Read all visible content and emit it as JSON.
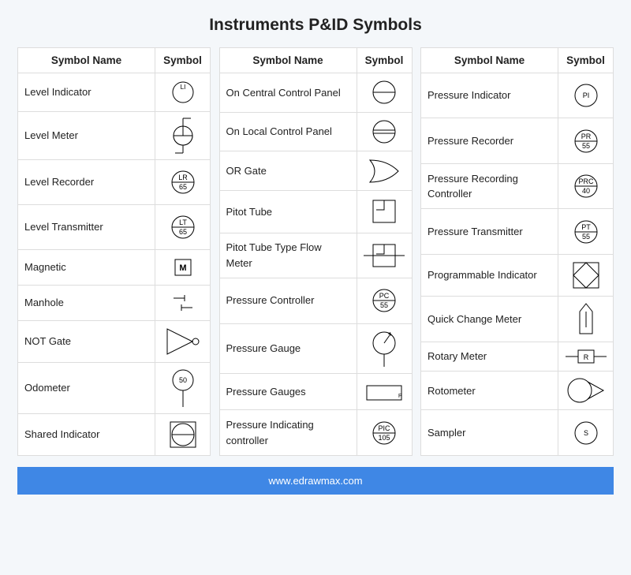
{
  "title": "Instruments P&ID Symbols",
  "headers": {
    "name": "Symbol Name",
    "symbol": "Symbol"
  },
  "footer": "www.edrawmax.com",
  "columns": [
    [
      {
        "name": "Level Indicator",
        "symbol": "level-indicator"
      },
      {
        "name": "Level Meter",
        "symbol": "level-meter"
      },
      {
        "name": "Level Recorder",
        "symbol": "level-recorder",
        "tag_top": "LR",
        "tag_bot": "65"
      },
      {
        "name": "Level Transmitter",
        "symbol": "level-transmitter",
        "tag_top": "LT",
        "tag_bot": "65"
      },
      {
        "name": "Magnetic",
        "symbol": "magnetic"
      },
      {
        "name": "Manhole",
        "symbol": "manhole"
      },
      {
        "name": "NOT Gate",
        "symbol": "not-gate"
      },
      {
        "name": "Odometer",
        "symbol": "odometer",
        "tag_top": "50"
      },
      {
        "name": "Shared Indicator",
        "symbol": "shared-indicator"
      }
    ],
    [
      {
        "name": "On Central Control Panel",
        "symbol": "on-central-control-panel"
      },
      {
        "name": "On Local Control Panel",
        "symbol": "on-local-control-panel"
      },
      {
        "name": "OR Gate",
        "symbol": "or-gate"
      },
      {
        "name": "Pitot Tube",
        "symbol": "pitot-tube"
      },
      {
        "name": "Pitot Tube Type Flow Meter",
        "symbol": "pitot-tube-flow-meter"
      },
      {
        "name": "Pressure Controller",
        "symbol": "pressure-controller",
        "tag_top": "PC",
        "tag_bot": "55"
      },
      {
        "name": "Pressure Gauge",
        "symbol": "pressure-gauge"
      },
      {
        "name": "Pressure Gauges",
        "symbol": "pressure-gauges"
      },
      {
        "name": "Pressure Indicating controller",
        "symbol": "pressure-indicating-controller",
        "tag_top": "PIC",
        "tag_bot": "105"
      }
    ],
    [
      {
        "name": "Pressure Indicator",
        "symbol": "pressure-indicator",
        "tag_top": "PI"
      },
      {
        "name": "Pressure Recorder",
        "symbol": "pressure-recorder",
        "tag_top": "PR",
        "tag_bot": "55"
      },
      {
        "name": "Pressure Recording Controller",
        "symbol": "pressure-recording-controller",
        "tag_top": "PRC",
        "tag_bot": "40"
      },
      {
        "name": "Pressure Transmitter",
        "symbol": "pressure-transmitter",
        "tag_top": "PT",
        "tag_bot": "55"
      },
      {
        "name": "Programmable Indicator",
        "symbol": "programmable-indicator"
      },
      {
        "name": "Quick Change Meter",
        "symbol": "quick-change-meter"
      },
      {
        "name": "Rotary Meter",
        "symbol": "rotary-meter"
      },
      {
        "name": "Rotometer",
        "symbol": "rotometer"
      },
      {
        "name": "Sampler",
        "symbol": "sampler",
        "tag_top": "S"
      }
    ]
  ]
}
